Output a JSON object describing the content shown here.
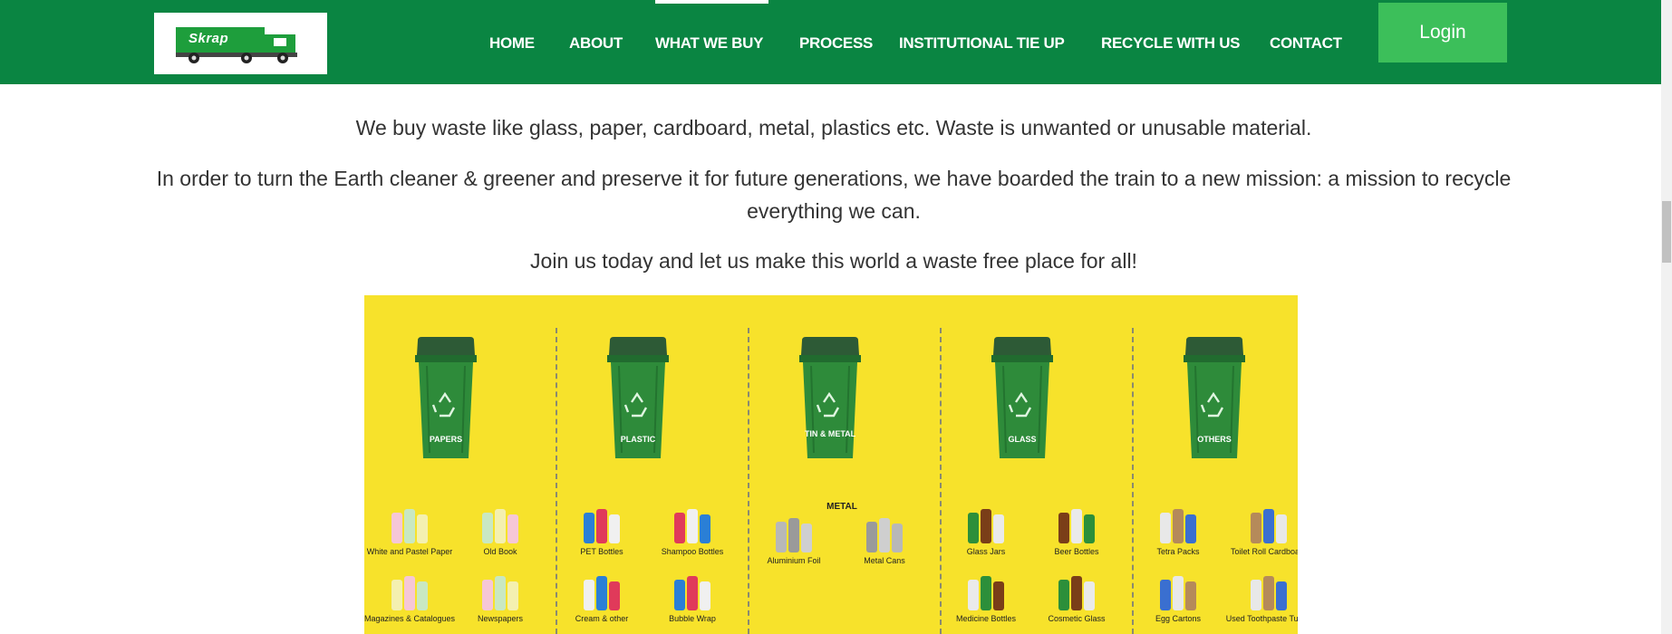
{
  "header": {
    "logo_text": "Skrap",
    "nav": [
      "HOME",
      "ABOUT",
      "WHAT WE BUY",
      "PROCESS",
      "INSTITUTIONAL TIE UP",
      "RECYCLE WITH US",
      "CONTACT"
    ],
    "active_nav": "WHAT WE BUY",
    "login_label": "Login"
  },
  "content": {
    "para1": "We buy waste like glass, paper, cardboard, metal, plastics etc. Waste is unwanted or unusable material.",
    "para2": "In order to turn the Earth cleaner & greener and preserve it for future generations, we have boarded the train to a new mission: a mission to recycle everything we can.",
    "para3": "Join us today and let us make this world a waste free place for all!"
  },
  "infographic": {
    "columns": [
      {
        "bin_label": "PAPERS",
        "section_head": "",
        "items": [
          "White and Pastel Paper",
          "Old Book",
          "Magazines & Catalogues",
          "Newspapers"
        ]
      },
      {
        "bin_label": "PLASTIC",
        "section_head": "",
        "items": [
          "PET Bottles",
          "Shampoo Bottles",
          "Cream & other",
          "Bubble Wrap"
        ]
      },
      {
        "bin_label": "TIN & METAL",
        "section_head": "METAL",
        "items": [
          "Aluminium Foil",
          "Metal Cans",
          "",
          ""
        ]
      },
      {
        "bin_label": "GLASS",
        "section_head": "",
        "items": [
          "Glass Jars",
          "Beer Bottles",
          "Medicine Bottles",
          "Cosmetic Glass"
        ]
      },
      {
        "bin_label": "OTHERS",
        "section_head": "",
        "items": [
          "Tetra Packs",
          "Toilet Roll Cardboard",
          "Egg Cartons",
          "Used Toothpaste Tubes"
        ]
      }
    ]
  },
  "colors": {
    "header_green": "#0a8542",
    "login_green": "#3cbf5a",
    "info_yellow": "#f7e22b",
    "bin_green": "#2e8b3a"
  }
}
